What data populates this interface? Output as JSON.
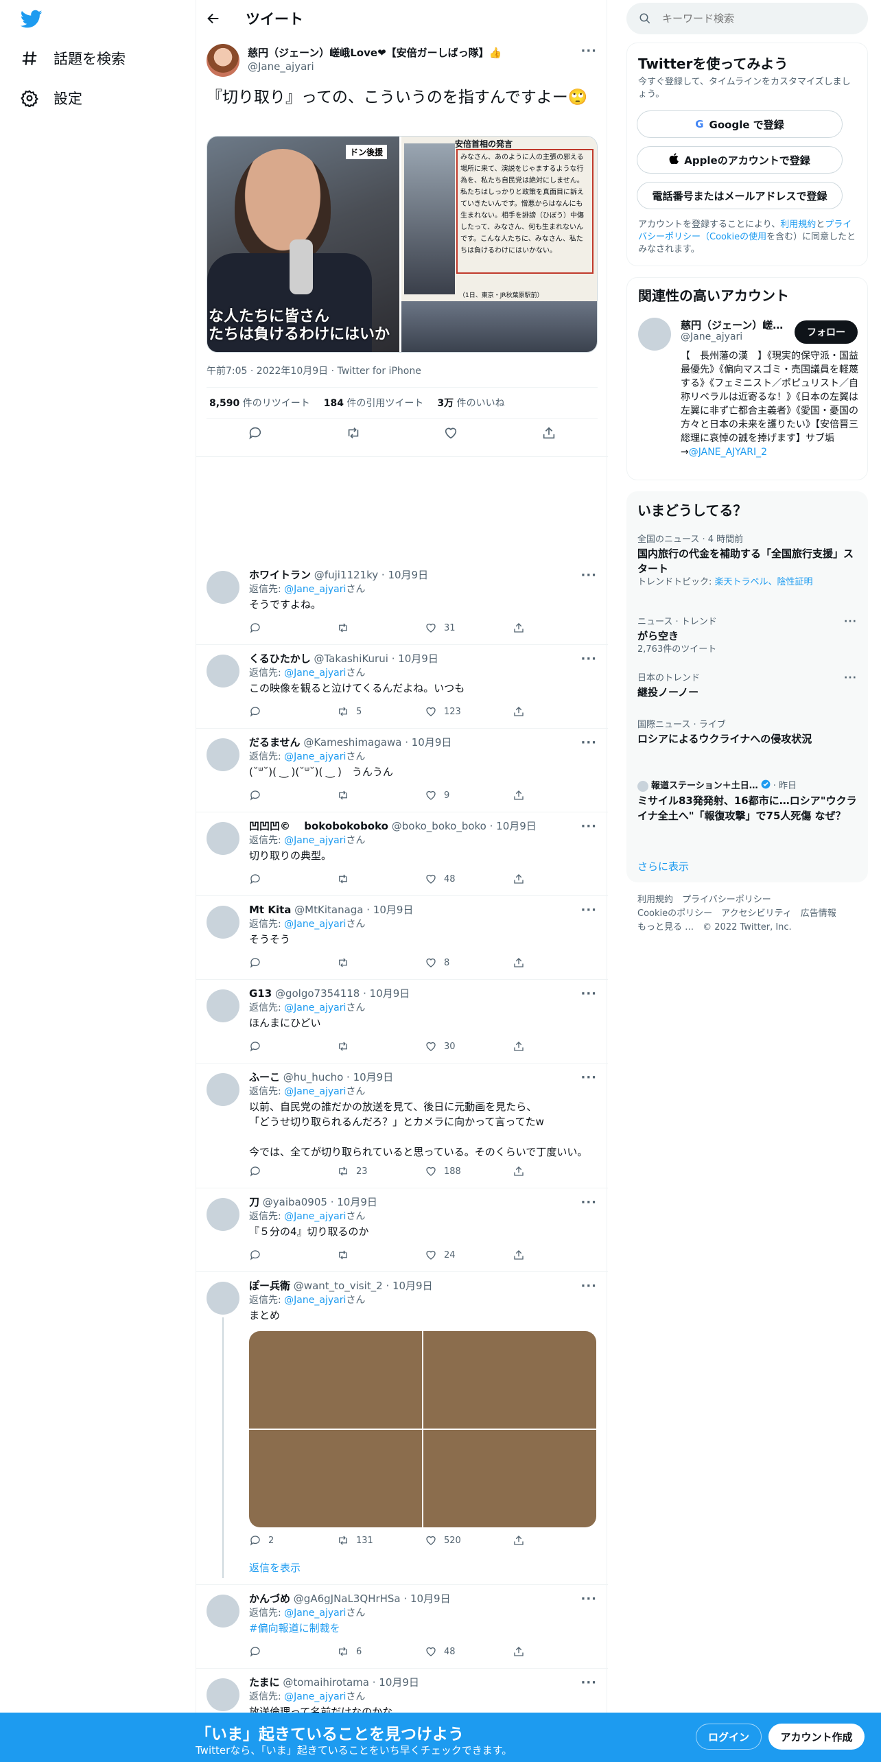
{
  "nav": {
    "explore_label": "話題を検索",
    "settings_label": "設定"
  },
  "header": {
    "title": "ツイート"
  },
  "tweet": {
    "display_name": "慈円（ジェーン）嵯峨Love❤【安倍ガーしばっ隊】👍",
    "handle": "@Jane_ajyari",
    "text": "『切り取り』っての、こういうのを指すんですよー🙄",
    "image_left": {
      "badge": "ドン後援",
      "caption": "な人たちに皆さん\nたちは負けるわけにはいか"
    },
    "image_right": {
      "heading": "安倍首相の発言",
      "body": "みなさん、あのように人の主張の邪える場所に来て、演説をじゃまするような行為を、私たち自民党は絶対にしません。私たちはしっかりと政策を真面目に訴えていきたいんです。憎悪からはなんにも生まれない。相手を誹謗（ひぼう）中傷したって、みなさん、何も生まれないんです。こんな人たちに、みなさん、私たちは負けるわけにはいかない。",
      "source": "（1日、東京・JR秋葉原駅前）"
    },
    "timestamp": "午前7:05 · 2022年10月9日 · Twitter for iPhone",
    "retweets_num": "8,590",
    "retweets_label": "件のリツイート",
    "quotes_num": "184",
    "quotes_label": "件の引用ツイート",
    "likes_num": "3万",
    "likes_label": "件のいいね"
  },
  "replies": [
    {
      "name": "ホワイトラン",
      "handle": "@fuji1121ky",
      "date": "· 10月9日",
      "reply_to": "@Jane_ajyari",
      "text": "そうですよね。",
      "retweets": "",
      "likes": "31"
    },
    {
      "name": "くるひたかし",
      "handle": "@TakashiKurui",
      "date": "· 10月9日",
      "reply_to": "@Jane_ajyari",
      "text": "この映像を観ると泣けてくるんだよね。いつも",
      "retweets": "5",
      "likes": "123"
    },
    {
      "name": "だるません",
      "handle": "@Kameshimagawa",
      "date": "· 10月9日",
      "reply_to": "@Jane_ajyari",
      "text": "(˘ᐜ˘)( ‿ )(˘ᐜ˘)( ‿ )　うんうん",
      "retweets": "",
      "likes": "9"
    },
    {
      "name": "凹凹凹©　 bokobokoboko",
      "handle": "@boko_boko_boko",
      "date": "· 10月9日",
      "reply_to": "@Jane_ajyari",
      "text": "切り取りの典型。",
      "retweets": "",
      "likes": "48"
    },
    {
      "name": "Mt Kita",
      "handle": "@MtKitanaga",
      "date": "· 10月9日",
      "reply_to": "@Jane_ajyari",
      "text": "そうそう",
      "retweets": "",
      "likes": "8"
    },
    {
      "name": "G13",
      "handle": "@golgo7354118",
      "date": "· 10月9日",
      "reply_to": "@Jane_ajyari",
      "text": "ほんまにひどい",
      "retweets": "",
      "likes": "30"
    },
    {
      "name": "ふーこ",
      "handle": "@hu_hucho",
      "date": "· 10月9日",
      "reply_to": "@Jane_ajyari",
      "text": "以前、自民党の誰だかの放送を見て、後日に元動画を見たら、\n「どうせ切り取られるんだろ？」とカメラに向かって言ってたw\n\n今では、全てが切り取られていると思っている。そのくらいで丁度いい。",
      "retweets": "23",
      "likes": "188"
    },
    {
      "name": "刀",
      "handle": "@yaiba0905",
      "date": "· 10月9日",
      "reply_to": "@Jane_ajyari",
      "text": "『５分の4』切り取るのか",
      "retweets": "",
      "likes": "24"
    },
    {
      "name": "ぽー兵衛",
      "handle": "@want_to_visit_2",
      "date": "· 10月9日",
      "reply_to": "@Jane_ajyari",
      "text": "まとめ",
      "replies_count": "2",
      "retweets": "131",
      "likes": "520",
      "show_replies": "返信を表示"
    },
    {
      "name": "かんづめ",
      "handle": "@gA6gJNaL3QHrHSa",
      "date": "· 10月9日",
      "reply_to": "@Jane_ajyari",
      "text": "#偏向報道に制裁を",
      "retweets": "6",
      "likes": "48"
    },
    {
      "name": "たまに",
      "handle": "@tomaihirotama",
      "date": "· 10月9日",
      "reply_to": "@Jane_ajyari",
      "text": "放送倫理って名前だけなのかな。。"
    }
  ],
  "reply_prefix": "返信先: ",
  "reply_suffix": "さん",
  "search": {
    "placeholder": "キーワード検索"
  },
  "signup": {
    "title": "Twitterを使ってみよう",
    "subtitle": "今すぐ登録して、タイムラインをカスタマイズしましょう。",
    "google": "Google で登録",
    "apple": "Appleのアカウントで登録",
    "phone": "電話番号またはメールアドレスで登録",
    "legal_pre": "アカウントを登録することにより、",
    "legal_terms": "利用規約",
    "legal_and": "と",
    "legal_privacy": "プライバシーポリシー",
    "legal_cookie": "（Cookieの使用",
    "legal_post": "を含む）に同意したとみなされます。"
  },
  "related": {
    "title": "関連性の高いアカウント",
    "name": "慈円（ジェーン）嵯…",
    "handle": "@Jane_ajyari",
    "follow": "フォロー",
    "bio": "【　長州藩の漢　】《現実的保守派・国益最優先》《偏向マスゴミ・売国議員を軽蔑する》《フェミニスト／ポピュリスト／自称リベラルは近寄るな！》《日本の左翼は左翼に非ず亡都合主義者》《愛国・憂国の方々と日本の未来を護りたい》【安倍晋三総理に哀悼の誠を捧げます】サブ垢→",
    "bio_link": "@JANE_AJYARI_2"
  },
  "trends": {
    "title": "いまどうしてる？",
    "items": [
      {
        "meta": "全国のニュース · 4 時間前",
        "title": "国内旅行の代金を補助する「全国旅行支援」スタート",
        "topic_pre": "トレンドトピック: ",
        "topic": "楽天トラベル、陰性証明"
      },
      {
        "meta": "ニュース · トレンド",
        "title": "がら空き",
        "sub": "2,763件のツイート"
      },
      {
        "meta": "日本のトレンド",
        "title": "継投ノーノー"
      },
      {
        "meta": "国際ニュース · ライブ",
        "title": "ロシアによるウクライナへの侵攻状況"
      },
      {
        "meta_name": "報道ステーション＋土日…",
        "meta_time": " · 昨日",
        "title": "ミサイル83発発射、16都市に…ロシア\"ウクライナ全土へ\"「報復攻撃」で75人死傷 なぜ？"
      }
    ],
    "show_more": "さらに表示"
  },
  "footer": {
    "links": [
      "利用規約",
      "プライバシーポリシー",
      "Cookieのポリシー",
      "アクセシビリティ",
      "広告情報",
      "もっと見る …"
    ],
    "copyright": "© 2022 Twitter, Inc."
  },
  "bottom": {
    "title": "「いま」起きていることを見つけよう",
    "subtitle": "Twitterなら、「いま」起きていることをいち早くチェックできます。",
    "login": "ログイン",
    "signup": "アカウント作成"
  },
  "colors": {
    "accent": "#1d9bf0",
    "text": "#0f1419",
    "muted": "#536471"
  }
}
